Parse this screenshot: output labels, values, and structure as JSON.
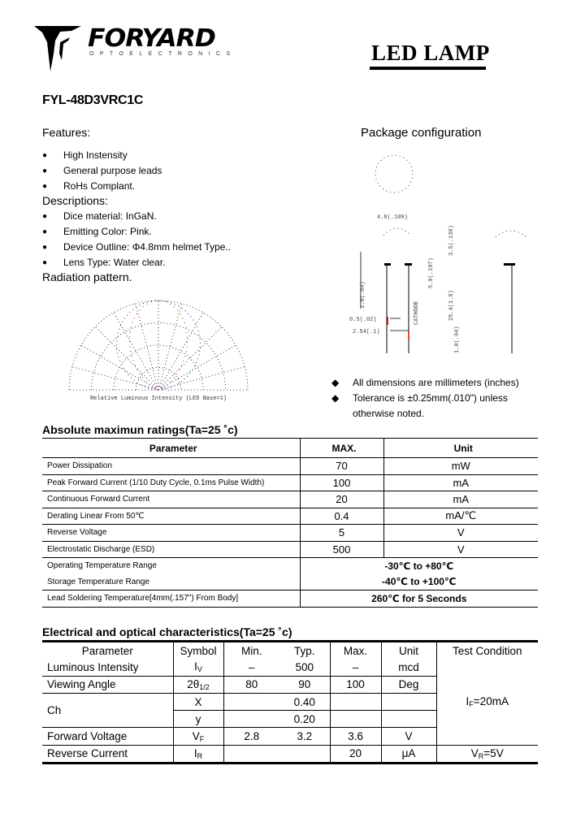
{
  "header": {
    "brand": "FORYARD",
    "brand_sub": "OPTOELECTRONICS",
    "doc_title": "LED LAMP",
    "part_number": "FYL-48D3VRC1C"
  },
  "features": {
    "heading": "Features:",
    "items": [
      "High Instensity",
      "General purpose leads",
      "RoHs Complant."
    ]
  },
  "descriptions": {
    "heading": "Descriptions:",
    "items": [
      "Dice material: InGaN.",
      "Emitting Color: Pink.",
      "Device Outline: Φ4.8mm helmet Type..",
      "Lens Type: Water clear."
    ]
  },
  "radiation": {
    "heading": "Radiation pattern.",
    "caption": "Relative Luminous Intensity (LED Base=1)",
    "colors": {
      "grid": "#000000",
      "curve_a": "#1a1aa8",
      "curve_b": "#cc1111"
    }
  },
  "package": {
    "heading": "Package configuration",
    "dims": {
      "diameter": "4.8(.189)",
      "dome": "3.5(.138)",
      "lead_w": "0.5(.02)",
      "pitch": "2.54(.1)",
      "body": "5.0(.197)",
      "lead_len": "25.4(1.0)",
      "flange": "1.0(.04)",
      "min": "1.0(.04)",
      "cathode": "CATHODE"
    },
    "notes": [
      "All dimensions are millimeters (inches)",
      "Tolerance is ±0.25mm(.010\") unless otherwise noted."
    ]
  },
  "abs_max": {
    "title": "Absolute maximun ratings(Ta=25 ˚c)",
    "columns": [
      "Parameter",
      "MAX.",
      "Unit"
    ],
    "rows": [
      {
        "param": "Power Dissipation",
        "max": "70",
        "unit": "mW"
      },
      {
        "param": "Peak Forward Current (1/10 Duty Cycle, 0.1ms Pulse Width)",
        "max": "100",
        "unit": "mA"
      },
      {
        "param": "Continuous Forward Current",
        "max": "20",
        "unit": "mA"
      },
      {
        "param": "Derating Linear From 50℃",
        "max": "0.4",
        "unit": "mA/℃"
      },
      {
        "param": "Reverse Voltage",
        "max": "5",
        "unit": "V"
      },
      {
        "param": "Electrostatic Discharge (ESD)",
        "max": "500",
        "unit": "V"
      }
    ],
    "span_rows": [
      {
        "param": "Operating Temperature Range",
        "value": "-30℃ to +80℃"
      },
      {
        "param": "Storage Temperature Range",
        "value": "-40℃ to +100℃"
      },
      {
        "param": "Lead Soldering Temperature[4mm(.157\") From Body]",
        "value": "260℃ for 5 Seconds"
      }
    ]
  },
  "electrical": {
    "title": "Electrical and optical characteristics(Ta=25 ˚c)",
    "columns": [
      "Parameter",
      "Symbol",
      "Min.",
      "Typ.",
      "Max.",
      "Unit",
      "Test Condition"
    ],
    "rows": [
      {
        "param": "Luminous Intensity",
        "sym": "I",
        "sym_sub": "V",
        "min": "–",
        "typ": "500",
        "max": "–",
        "unit": "mcd"
      },
      {
        "param": "Viewing Angle",
        "sym": "2θ",
        "sym_sub": "1/2",
        "min": "80",
        "typ": "90",
        "max": "100",
        "unit": "Deg"
      },
      {
        "param": "Ch",
        "sym": "X",
        "sym_sub": "",
        "min": "",
        "typ": "0.40",
        "max": "",
        "unit": ""
      },
      {
        "param": "",
        "sym": "y",
        "sym_sub": "",
        "min": "",
        "typ": "0.20",
        "max": "",
        "unit": ""
      },
      {
        "param": "Forward Voltage",
        "sym": "V",
        "sym_sub": "F",
        "min": "2.8",
        "typ": "3.2",
        "max": "3.6",
        "unit": "V"
      },
      {
        "param": "Reverse Current",
        "sym": "I",
        "sym_sub": "R",
        "min": "",
        "typ": "",
        "max": "20",
        "unit": "μA"
      }
    ],
    "test_cond_main": {
      "pre": "I",
      "sub": "F",
      "post": "=20mA"
    },
    "test_cond_reverse": {
      "pre": "V",
      "sub": "R",
      "post": "=5V"
    }
  }
}
